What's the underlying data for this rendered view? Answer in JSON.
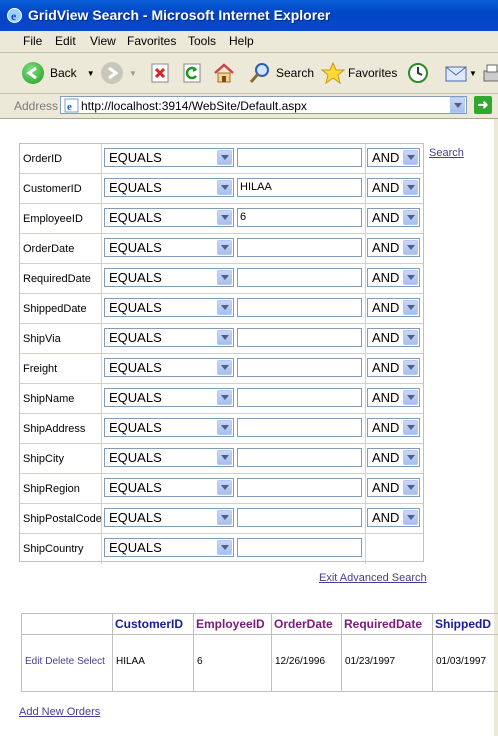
{
  "window": {
    "title": "GridView Search - Microsoft Internet Explorer"
  },
  "menu": [
    "File",
    "Edit",
    "View",
    "Favorites",
    "Tools",
    "Help"
  ],
  "toolbar": {
    "back": "Back",
    "search": "Search",
    "favorites": "Favorites"
  },
  "address": {
    "label": "Address",
    "url": "http://localhost:3914/WebSite/Default.aspx"
  },
  "filters": [
    {
      "field": "OrderID",
      "op": "EQUALS",
      "value": "",
      "join": "AND"
    },
    {
      "field": "CustomerID",
      "op": "EQUALS",
      "value": "HILAA",
      "join": "AND"
    },
    {
      "field": "EmployeeID",
      "op": "EQUALS",
      "value": "6",
      "join": "AND"
    },
    {
      "field": "OrderDate",
      "op": "EQUALS",
      "value": "",
      "join": "AND"
    },
    {
      "field": "RequiredDate",
      "op": "EQUALS",
      "value": "",
      "join": "AND"
    },
    {
      "field": "ShippedDate",
      "op": "EQUALS",
      "value": "",
      "join": "AND"
    },
    {
      "field": "ShipVia",
      "op": "EQUALS",
      "value": "",
      "join": "AND"
    },
    {
      "field": "Freight",
      "op": "EQUALS",
      "value": "",
      "join": "AND"
    },
    {
      "field": "ShipName",
      "op": "EQUALS",
      "value": "",
      "join": "AND"
    },
    {
      "field": "ShipAddress",
      "op": "EQUALS",
      "value": "",
      "join": "AND"
    },
    {
      "field": "ShipCity",
      "op": "EQUALS",
      "value": "",
      "join": "AND"
    },
    {
      "field": "ShipRegion",
      "op": "EQUALS",
      "value": "",
      "join": "AND"
    },
    {
      "field": "ShipPostalCode",
      "op": "EQUALS",
      "value": "",
      "join": "AND"
    },
    {
      "field": "ShipCountry",
      "op": "EQUALS",
      "value": "",
      "join": ""
    }
  ],
  "links": {
    "search": "Search",
    "exit_advanced": "Exit Advanced Search",
    "add_new": "Add New Orders"
  },
  "grid": {
    "columns": [
      "",
      "CustomerID",
      "EmployeeID",
      "OrderDate",
      "RequiredDate",
      "ShippedD"
    ],
    "rows": [
      {
        "actions": [
          "Edit",
          "Delete",
          "Select"
        ],
        "customer": "HILAA",
        "employee": "6",
        "order_date": "12/26/1996",
        "required_date": "01/23/1997",
        "shipped_date": "01/03/1997"
      }
    ]
  },
  "colors": {
    "titlebar": "#0a5fd8",
    "link": "#4a3c8c",
    "header_text": "#1a1a9a"
  }
}
